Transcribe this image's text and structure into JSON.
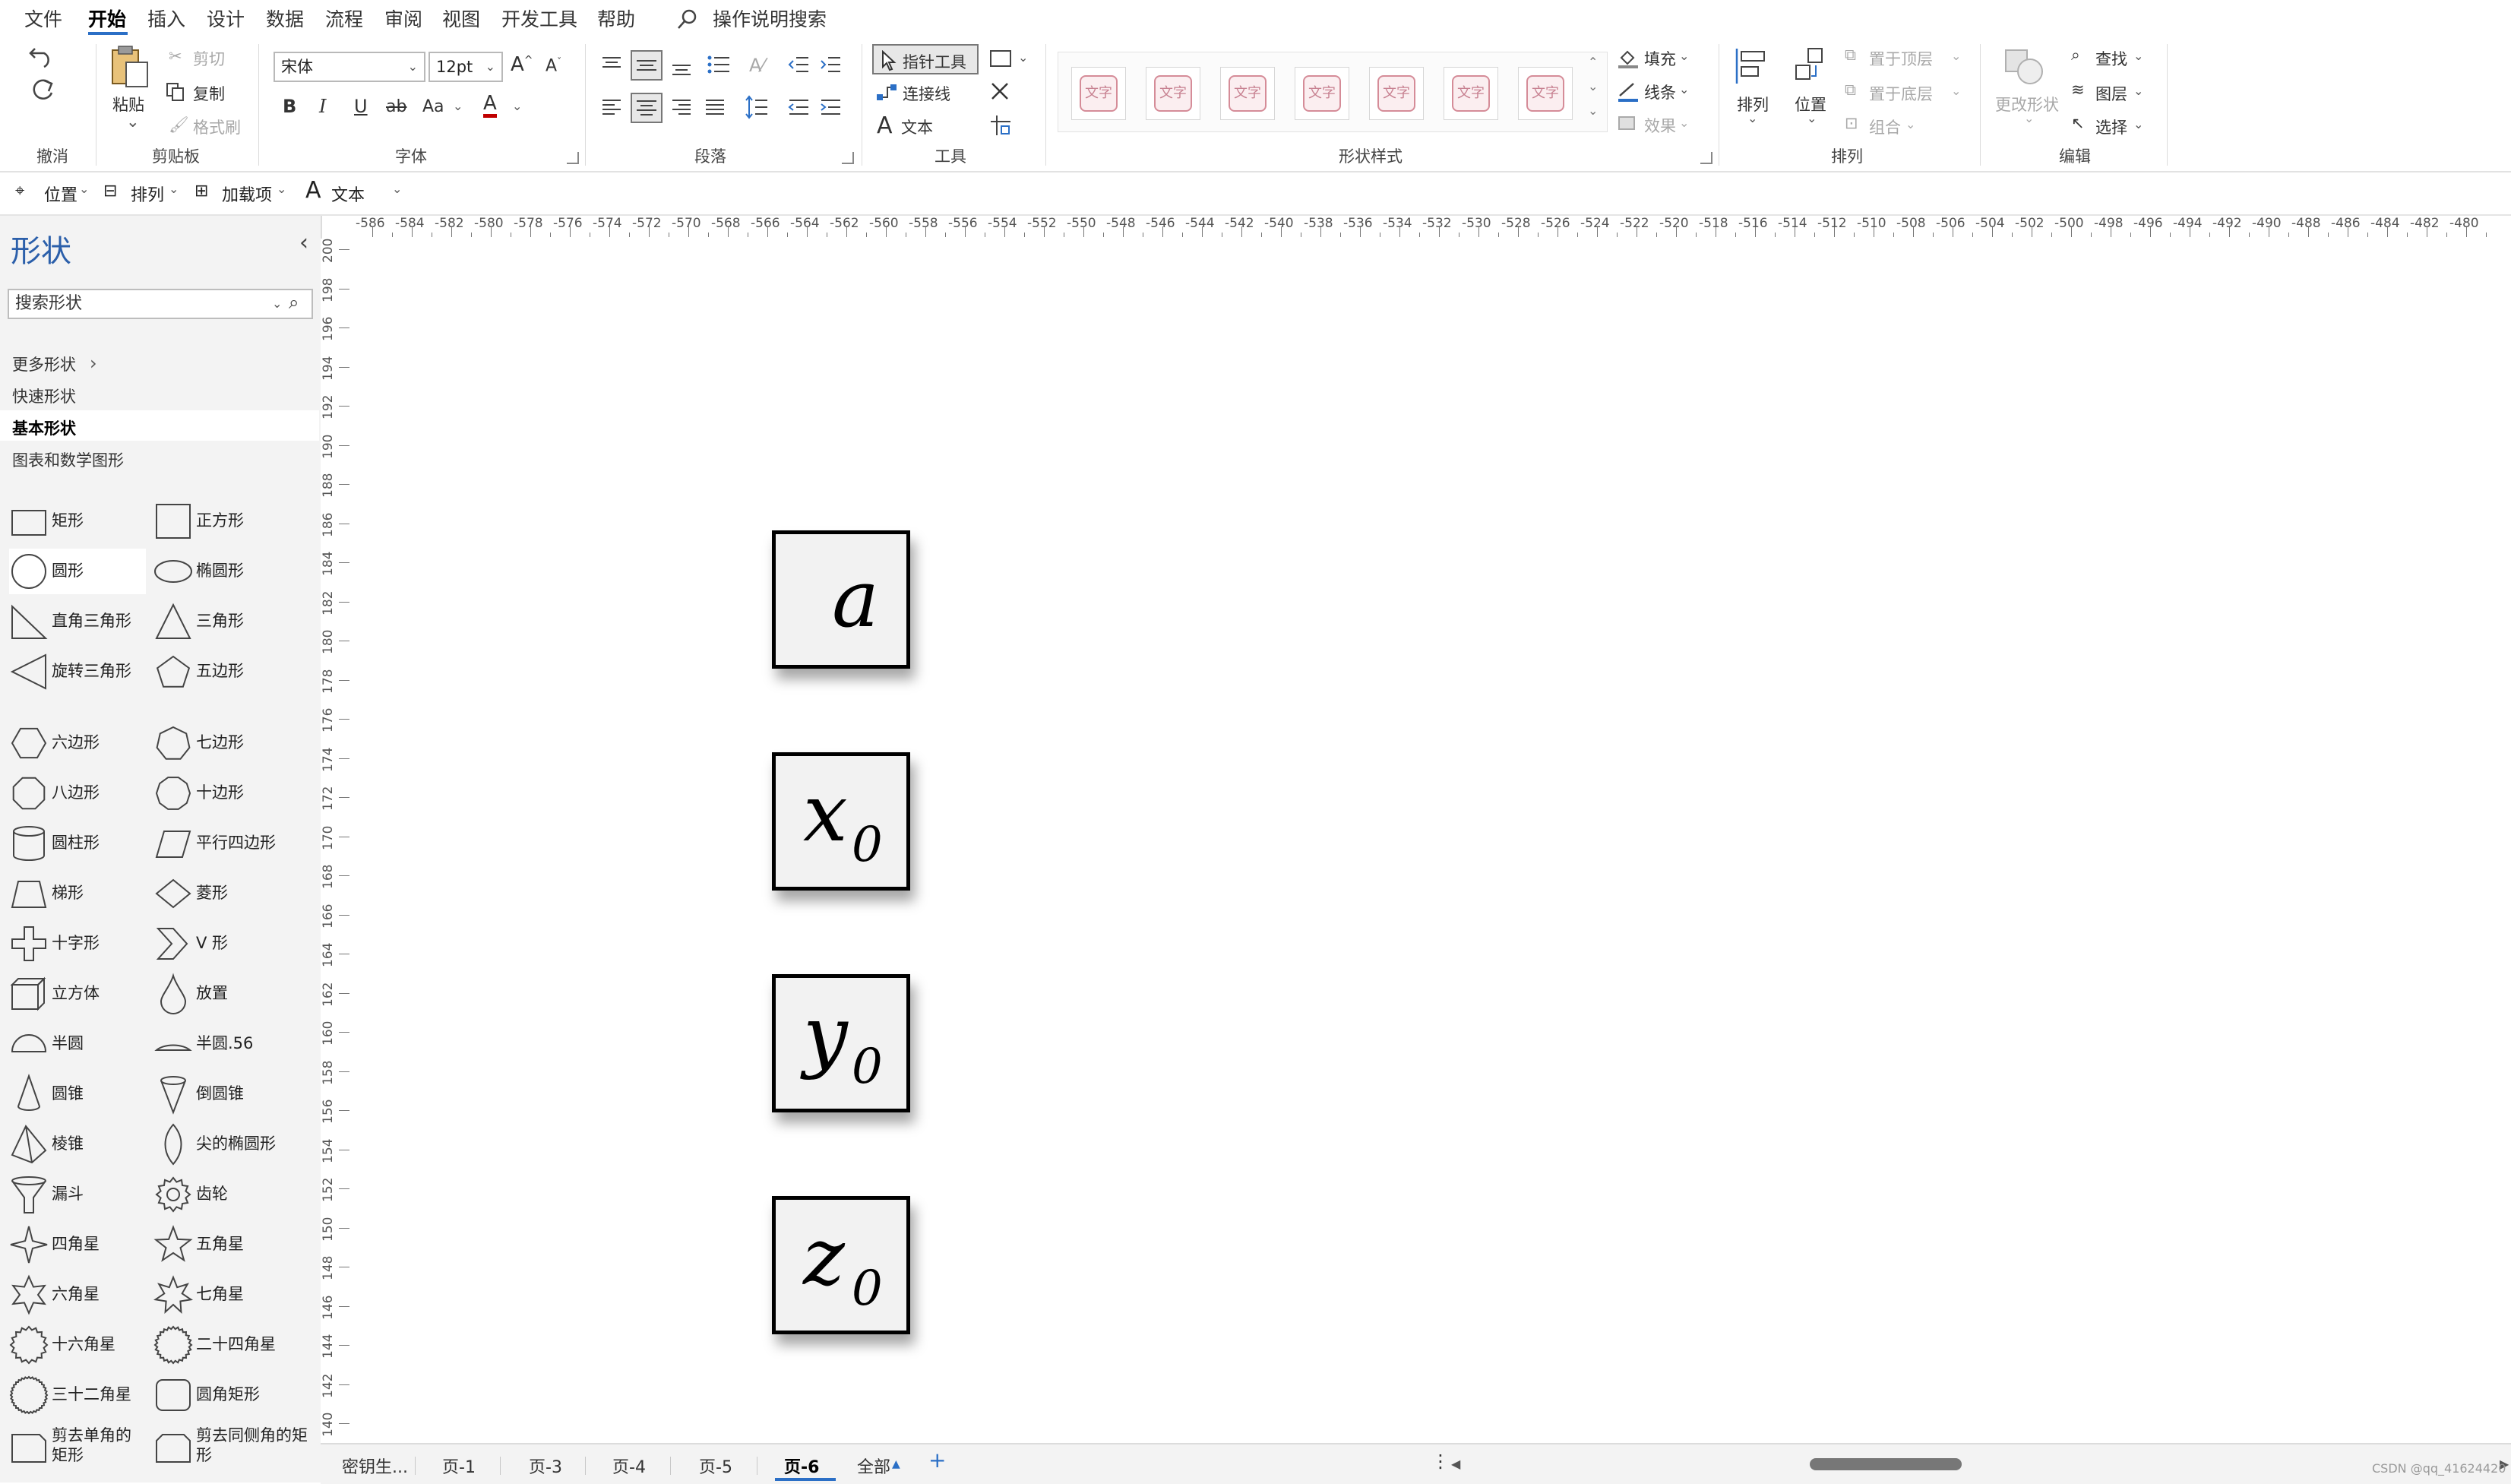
{
  "menu": {
    "items": [
      "文件",
      "开始",
      "插入",
      "设计",
      "数据",
      "流程",
      "审阅",
      "视图",
      "开发工具",
      "帮助"
    ],
    "active": "开始",
    "search_label": "操作说明搜索"
  },
  "ribbon": {
    "groups": {
      "undo": "撤消",
      "clipboard": "剪贴板",
      "font": "字体",
      "paragraph": "段落",
      "tools": "工具",
      "shape_style": "形状样式",
      "arrange": "排列",
      "edit": "编辑"
    },
    "clipboard": {
      "paste": "粘贴",
      "cut": "剪切",
      "copy": "复制",
      "format_painter": "格式刷"
    },
    "font": {
      "name": "宋体",
      "size": "12pt",
      "bold": "B",
      "italic": "I",
      "underline": "U",
      "strike": "ab",
      "case": "Aa",
      "color": "A"
    },
    "tools": {
      "pointer": "指针工具",
      "connector": "连接线",
      "text": "文本"
    },
    "shape_style": {
      "swatch_text": "文字"
    },
    "fill": {
      "fill": "填充",
      "line": "线条",
      "effect": "效果"
    },
    "arrange": {
      "arrange": "排列",
      "position": "位置",
      "bring_front": "置于顶层",
      "send_back": "置于底层",
      "group": "组合"
    },
    "edit": {
      "change_shape": "更改形状",
      "find": "查找",
      "layers": "图层",
      "select": "选择"
    }
  },
  "qat": {
    "position": "位置",
    "arrange": "排列",
    "addins": "加载项",
    "text": "文本"
  },
  "panel": {
    "title": "形状",
    "search_placeholder": "搜索形状",
    "links": [
      "更多形状",
      "快速形状",
      "基本形状",
      "图表和数学图形"
    ],
    "selected_link": "基本形状",
    "shapes": [
      "矩形",
      "正方形",
      "圆形",
      "椭圆形",
      "直角三角形",
      "三角形",
      "旋转三角形",
      "五边形",
      "六边形",
      "七边形",
      "八边形",
      "十边形",
      "圆柱形",
      "平行四边形",
      "梯形",
      "菱形",
      "十字形",
      "V 形",
      "立方体",
      "放置",
      "半圆",
      "半圆.56",
      "圆锥",
      "倒圆锥",
      "棱锥",
      "尖的椭圆形",
      "漏斗",
      "齿轮",
      "四角星",
      "五角星",
      "六角星",
      "七角星",
      "十六角星",
      "二十四角星",
      "三十二角星",
      "圆角矩形",
      "剪去单角的矩形",
      "剪去同侧角的矩形"
    ]
  },
  "rulers": {
    "h_start": -586,
    "h_end": -478,
    "h_step": 2,
    "v_start": 200,
    "v_end": 140,
    "v_step": 2
  },
  "canvas": {
    "variables": [
      {
        "base": "a",
        "sub": ""
      },
      {
        "base": "x",
        "sub": "0"
      },
      {
        "base": "y",
        "sub": "0"
      },
      {
        "base": "z",
        "sub": "0"
      }
    ]
  },
  "tabs": {
    "items": [
      "密钥生...",
      "页-1",
      "页-3",
      "页-4",
      "页-5",
      "页-6"
    ],
    "active": "页-6",
    "all": "全部",
    "add": "+"
  },
  "watermark": "CSDN @qq_41624420"
}
